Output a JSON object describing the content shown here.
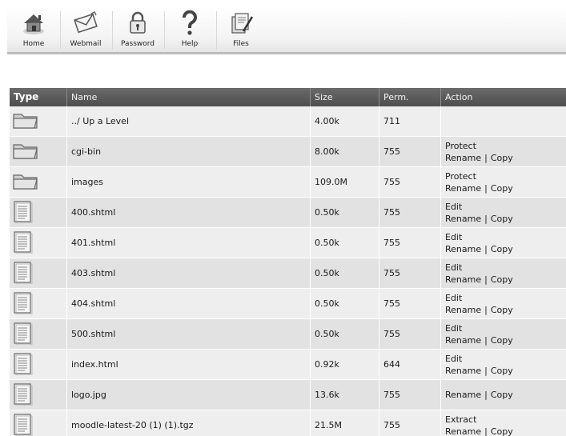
{
  "toolbar": {
    "buttons": [
      {
        "label": "Home",
        "icon": "home-icon"
      },
      {
        "label": "Webmail",
        "icon": "mail-icon"
      },
      {
        "label": "Password",
        "icon": "lock-icon"
      },
      {
        "label": "Help",
        "icon": "question-icon"
      },
      {
        "label": "Files",
        "icon": "files-icon"
      }
    ]
  },
  "table": {
    "headers": {
      "type": "Type",
      "name": "Name",
      "size": "Size",
      "perm": "Perm.",
      "action": "Action"
    },
    "rows": [
      {
        "icon": "folder-icon",
        "name": "../ Up a Level",
        "size": "4.00k",
        "perm": "711",
        "action_top": "",
        "rename": "",
        "copy": ""
      },
      {
        "icon": "folder-icon",
        "name": "cgi-bin",
        "size": "8.00k",
        "perm": "755",
        "action_top": "Protect",
        "rename": "Rename",
        "copy": "Copy"
      },
      {
        "icon": "folder-icon",
        "name": "images",
        "size": "109.0M",
        "perm": "755",
        "action_top": "Protect",
        "rename": "Rename",
        "copy": "Copy"
      },
      {
        "icon": "file-icon",
        "name": "400.shtml",
        "size": "0.50k",
        "perm": "755",
        "action_top": "Edit",
        "rename": "Rename",
        "copy": "Copy"
      },
      {
        "icon": "file-icon",
        "name": "401.shtml",
        "size": "0.50k",
        "perm": "755",
        "action_top": "Edit",
        "rename": "Rename",
        "copy": "Copy"
      },
      {
        "icon": "file-icon",
        "name": "403.shtml",
        "size": "0.50k",
        "perm": "755",
        "action_top": "Edit",
        "rename": "Rename",
        "copy": "Copy"
      },
      {
        "icon": "file-icon",
        "name": "404.shtml",
        "size": "0.50k",
        "perm": "755",
        "action_top": "Edit",
        "rename": "Rename",
        "copy": "Copy"
      },
      {
        "icon": "file-icon",
        "name": "500.shtml",
        "size": "0.50k",
        "perm": "755",
        "action_top": "Edit",
        "rename": "Rename",
        "copy": "Copy"
      },
      {
        "icon": "file-icon",
        "name": "index.html",
        "size": "0.92k",
        "perm": "644",
        "action_top": "Edit",
        "rename": "Rename",
        "copy": "Copy"
      },
      {
        "icon": "file-icon",
        "name": "logo.jpg",
        "size": "13.6k",
        "perm": "755",
        "action_top": "",
        "rename": "Rename",
        "copy": "Copy"
      },
      {
        "icon": "file-icon",
        "name": "moodle-latest-20 (1) (1).tgz",
        "size": "21.5M",
        "perm": "755",
        "action_top": "Extract",
        "rename": "Rename",
        "copy": "Copy"
      }
    ]
  }
}
